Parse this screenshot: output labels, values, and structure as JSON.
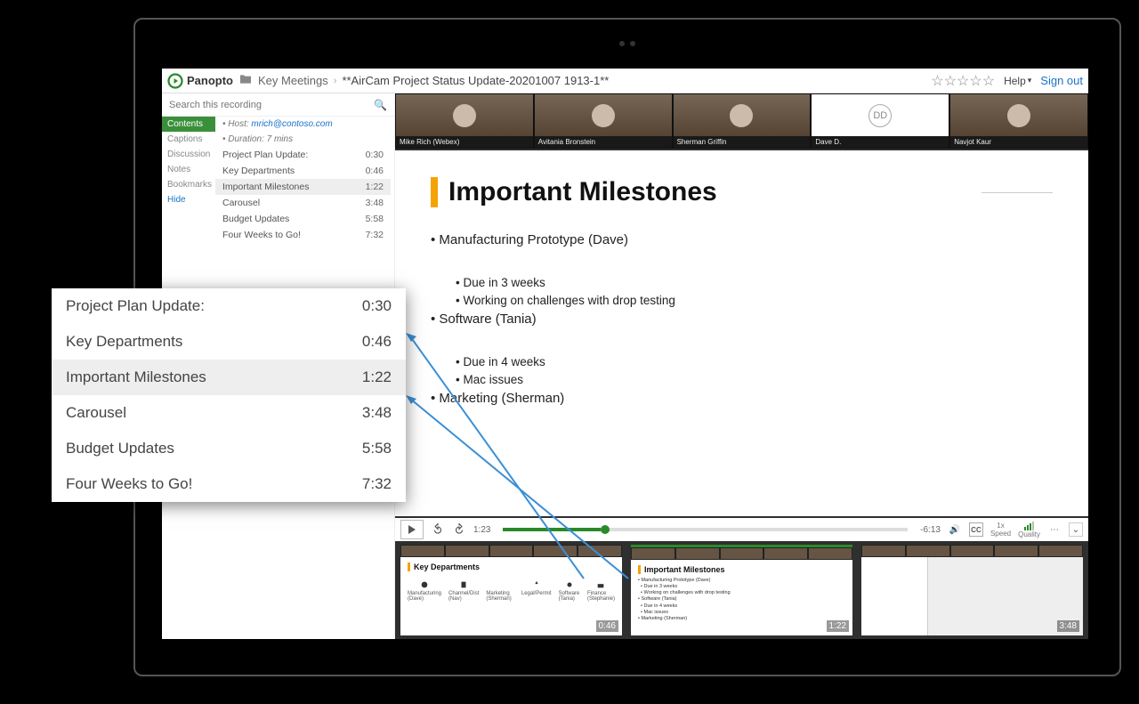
{
  "header": {
    "brand": "Panopto",
    "folder": "Key Meetings",
    "title": "**AirCam Project Status Update-20201007 1913-1**",
    "help": "Help",
    "signout": "Sign out"
  },
  "search": {
    "placeholder": "Search this recording"
  },
  "nav": {
    "contents": "Contents",
    "captions": "Captions",
    "discussion": "Discussion",
    "notes": "Notes",
    "bookmarks": "Bookmarks",
    "hide": "Hide"
  },
  "meta": {
    "host_label": "Host:",
    "host_email": "mrich@contoso.com",
    "duration": "Duration: 7 mins"
  },
  "toc": [
    {
      "label": "Project Plan Update:",
      "time": "0:30"
    },
    {
      "label": "Key Departments",
      "time": "0:46"
    },
    {
      "label": "Important Milestones",
      "time": "1:22",
      "selected": true
    },
    {
      "label": "Carousel",
      "time": "3:48"
    },
    {
      "label": "Budget Updates",
      "time": "5:58"
    },
    {
      "label": "Four Weeks to Go!",
      "time": "7:32"
    }
  ],
  "participants": [
    {
      "name": "Mike Rich (Webex)"
    },
    {
      "name": "Avitania Bronstein"
    },
    {
      "name": "Sherman Griffin"
    },
    {
      "name": "Dave D.",
      "initials": "DD"
    },
    {
      "name": "Navjot Kaur"
    }
  ],
  "slide": {
    "title": "Important Milestones",
    "l1a": "Manufacturing Prototype (Dave)",
    "l1a1": "Due in 3 weeks",
    "l1a2": "Working on challenges with drop testing",
    "l1b": "Software (Tania)",
    "l1b1": "Due in 4 weeks",
    "l1b2": "Mac issues",
    "l1c": "Marketing (Sherman)"
  },
  "controls": {
    "current": "1:23",
    "remaining": "-6:13",
    "speed_val": "1x",
    "speed_label": "Speed",
    "quality": "Quality",
    "cc": "CC",
    "rewind": "10",
    "forward": "10"
  },
  "thumbs": [
    {
      "title": "Key Departments",
      "time": "0:46",
      "icons": [
        "Manufacturing (Dave)",
        "Channel/Dist (Nav)",
        "Marketing (Sherman)",
        "Legal/Permit",
        "Software (Tania)",
        "Finance (Stephanie)"
      ]
    },
    {
      "title": "Important Milestones",
      "time": "1:22",
      "bullets": [
        "Manufacturing Prototype (Dave)",
        "Due in 3 weeks",
        "Working on challenges with drop testing",
        "Software (Tania)",
        "Due in 4 weeks",
        "Mac issues",
        "Marketing (Sherman)"
      ]
    },
    {
      "title": "",
      "time": "3:48"
    }
  ],
  "popout": [
    {
      "label": "Project Plan Update:",
      "time": "0:30"
    },
    {
      "label": "Key Departments",
      "time": "0:46"
    },
    {
      "label": "Important Milestones",
      "time": "1:22",
      "selected": true
    },
    {
      "label": "Carousel",
      "time": "3:48"
    },
    {
      "label": "Budget Updates",
      "time": "5:58"
    },
    {
      "label": "Four Weeks to Go!",
      "time": "7:32"
    }
  ]
}
